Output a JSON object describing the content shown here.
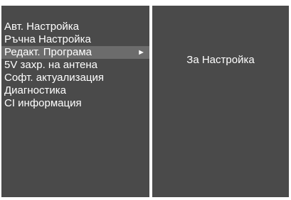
{
  "menu": {
    "items": [
      {
        "label": "Авт. Настройка"
      },
      {
        "label": "Ръчна Настройка"
      },
      {
        "label": "Редакт. Програма",
        "selected": true
      },
      {
        "label": "5V захр. на антена"
      },
      {
        "label": "Софт. актуализация"
      },
      {
        "label": "Диагностика"
      },
      {
        "label": "CI информация"
      }
    ],
    "submenu_arrow": "►"
  },
  "submenu": {
    "title": "За Настройка"
  },
  "colors": {
    "panel_bg": "#4a4a4a",
    "selected_bg": "#6c6c6c",
    "divider": "#ffffff",
    "text": "#ffffff"
  }
}
